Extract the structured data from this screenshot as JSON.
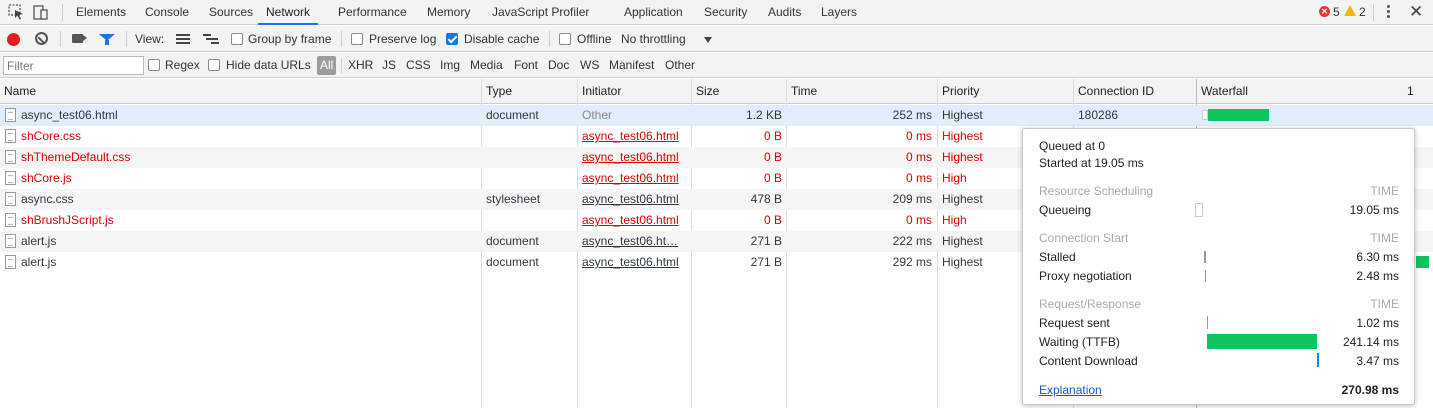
{
  "tabs": [
    "Elements",
    "Console",
    "Sources",
    "Network",
    "Performance",
    "Memory",
    "JavaScript Profiler",
    "Application",
    "Security",
    "Audits",
    "Layers"
  ],
  "active_tab": "Network",
  "status": {
    "errors": "5",
    "warnings": "2"
  },
  "toolbar": {
    "view_label": "View:",
    "group_by_frame": "Group by frame",
    "preserve_log": "Preserve log",
    "disable_cache": "Disable cache",
    "offline": "Offline",
    "throttling": "No throttling"
  },
  "filter": {
    "placeholder": "Filter",
    "regex": "Regex",
    "hide_data_urls": "Hide data URLs",
    "types": [
      "All",
      "XHR",
      "JS",
      "CSS",
      "Img",
      "Media",
      "Font",
      "Doc",
      "WS",
      "Manifest",
      "Other"
    ]
  },
  "columns": [
    "Name",
    "Type",
    "Initiator",
    "Size",
    "Time",
    "Priority",
    "Connection ID",
    "Waterfall"
  ],
  "sort_indicator": "1",
  "rows": [
    {
      "name": "async_test06.html",
      "type": "document",
      "initiator": "Other",
      "size": "1.2 KB",
      "time": "252 ms",
      "priority": "Highest",
      "connection": "180286"
    },
    {
      "name": "shCore.css",
      "type": "",
      "initiator": "async_test06.html",
      "size": "0 B",
      "time": "0 ms",
      "priority": "Highest",
      "connection": ""
    },
    {
      "name": "shThemeDefault.css",
      "type": "",
      "initiator": "async_test06.html",
      "size": "0 B",
      "time": "0 ms",
      "priority": "Highest",
      "connection": ""
    },
    {
      "name": "shCore.js",
      "type": "",
      "initiator": "async_test06.html",
      "size": "0 B",
      "time": "0 ms",
      "priority": "High",
      "connection": ""
    },
    {
      "name": "async.css",
      "type": "stylesheet",
      "initiator": "async_test06.html",
      "size": "478 B",
      "time": "209 ms",
      "priority": "Highest",
      "connection": ""
    },
    {
      "name": "shBrushJScript.js",
      "type": "",
      "initiator": "async_test06.html",
      "size": "0 B",
      "time": "0 ms",
      "priority": "High",
      "connection": ""
    },
    {
      "name": "alert.js",
      "type": "document",
      "initiator": "async_test06.ht…",
      "size": "271 B",
      "time": "222 ms",
      "priority": "Highest",
      "connection": ""
    },
    {
      "name": "alert.js",
      "type": "document",
      "initiator": "async_test06.html",
      "size": "271 B",
      "time": "292 ms",
      "priority": "Highest",
      "connection": ""
    }
  ],
  "timing": {
    "queued": "Queued at 0",
    "started": "Started at 19.05 ms",
    "scheduling_title": "Resource Scheduling",
    "connection_title": "Connection Start",
    "request_title": "Request/Response",
    "time_header": "TIME",
    "queueing_label": "Queueing",
    "queueing_value": "19.05 ms",
    "stalled_label": "Stalled",
    "stalled_value": "6.30 ms",
    "proxy_label": "Proxy negotiation",
    "proxy_value": "2.48 ms",
    "request_sent_label": "Request sent",
    "request_sent_value": "1.02 ms",
    "waiting_label": "Waiting (TTFB)",
    "waiting_value": "241.14 ms",
    "download_label": "Content Download",
    "download_value": "3.47 ms",
    "explanation": "Explanation",
    "total": "270.98 ms"
  },
  "colors": {
    "accent": "#1a73e8",
    "error": "#dd0000",
    "waterfall": "#0ec45e",
    "selected_row": "#e2edfb"
  }
}
